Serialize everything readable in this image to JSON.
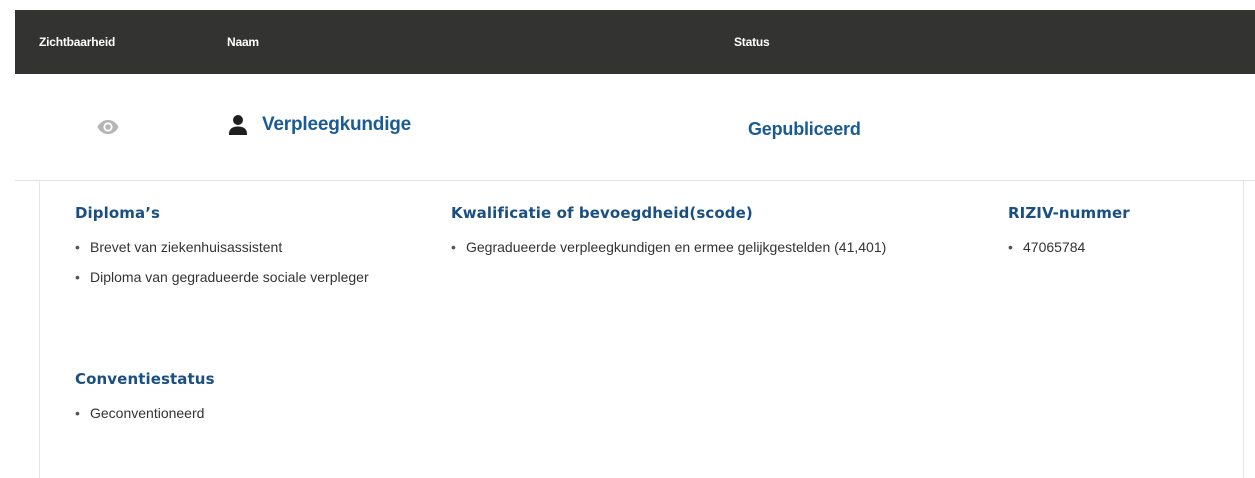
{
  "table": {
    "headers": {
      "visibility": "Zichtbaarheid",
      "name": "Naam",
      "status": "Status"
    }
  },
  "row": {
    "name": "Verpleegkundige",
    "status": "Gepubliceerd",
    "visibility_icon": "eye-icon",
    "profile_icon": "person-icon",
    "accent_color": "#1a5b93"
  },
  "details": {
    "diplomas": {
      "title": "Diploma’s",
      "items": [
        "Brevet van ziekenhuisassistent",
        "Diploma van gegradueerde sociale verpleger"
      ]
    },
    "qualification": {
      "title": "Kwalificatie of bevoegdheid(scode)",
      "items": [
        "Gegradueerde verpleegkundigen en ermee gelijkgestelden (41,401)"
      ]
    },
    "riziv": {
      "title": "RIZIV-nummer",
      "items": [
        "47065784"
      ]
    },
    "convention": {
      "title": "Conventiestatus",
      "items": [
        "Geconventioneerd"
      ]
    }
  }
}
